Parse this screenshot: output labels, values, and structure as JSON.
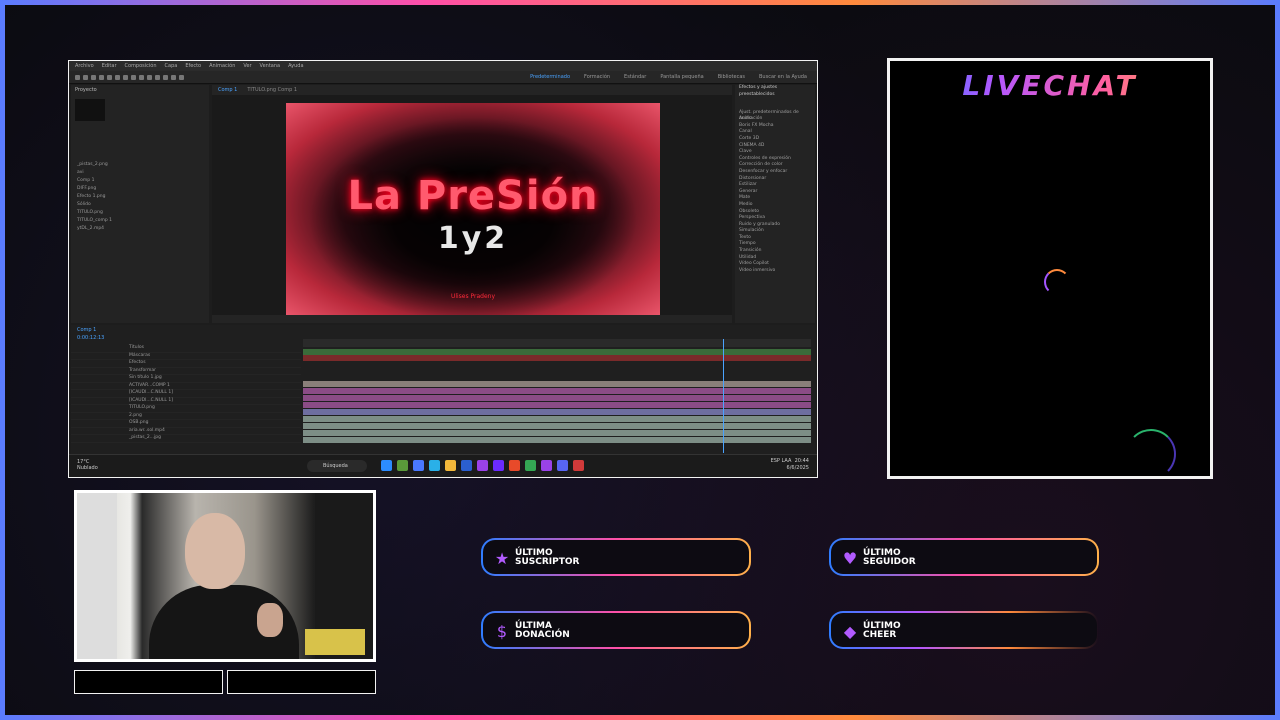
{
  "colors": {
    "accent_blue": "#2f7dff",
    "accent_pink": "#ff4fa8",
    "accent_orange": "#ffb04a",
    "ae_highlight": "#4aa3ff"
  },
  "ae": {
    "menu": [
      "Archivo",
      "Editar",
      "Composición",
      "Capa",
      "Efecto",
      "Animación",
      "Ver",
      "Ventana",
      "Ayuda"
    ],
    "workspaces": [
      "Predeterminado",
      "Formación",
      "Estándar",
      "Pantalla pequeña",
      "Bibliotecas"
    ],
    "search_help": "Buscar en la Ayuda",
    "project_title": "Proyecto",
    "project_items": [
      "_pistas_2.png",
      "avi",
      "Comp 1",
      "DIFF.png",
      "Efecto 1.png",
      "Sólido",
      "TITULO.png",
      "TITULO_comp 1",
      "ytDL_2.mp4"
    ],
    "comp_tabs": [
      "Comp 1",
      "TITULO.png Comp 1"
    ],
    "viewer": {
      "title_line1": "La PreSión",
      "title_line2": "1y2",
      "signature": "Ulises Pradeny"
    },
    "effects_title": "Efectos y ajustes preestablecidos",
    "effects_list": [
      "Ajust. predeterminados de animación",
      "Audio",
      "Boris FX Mocha",
      "Canal",
      "Corte 3D",
      "CINEMA 4D",
      "Clave",
      "Controles de expresión",
      "Corrección de color",
      "Desenfocar y enfocar",
      "Distorsionar",
      "Estilizar",
      "Generar",
      "Mate",
      "Medio",
      "Obsoleto",
      "Perspectiva",
      "Ruido y granulado",
      "Simulación",
      "Texto",
      "Tiempo",
      "Transición",
      "Utilidad",
      "Vídeo Copilot",
      "Vídeo inmersivo"
    ],
    "timeline_tab": "Comp 1",
    "timecode": "0:00:12:13",
    "layers": [
      "Títulos",
      "Máscaras",
      "Efectos",
      "Transformar",
      "Sin título 1.jpg",
      "ACTIVAR...COMP 1",
      "[ICAUDI...C.NULL 1]",
      "[ICAUDI...C.NULL 1]",
      "TITULO.png",
      "2.png",
      "OSB.png",
      "aria.wr..sol.mp4",
      "_pistas_2...jpg"
    ],
    "taskbar": {
      "search": "Búsqueda",
      "left": "17°C Nublado",
      "time": "20:44",
      "date": "6/6/2025",
      "lang": "ESP LAA"
    }
  },
  "chat": {
    "title": "LIVECHAT"
  },
  "alerts": [
    {
      "line1": "ÚLTIMO",
      "line2": "SUSCRIPTOR",
      "icon": "star-icon"
    },
    {
      "line1": "ÚLTIMO",
      "line2": "SEGUIDOR",
      "icon": "heart-icon"
    },
    {
      "line1": "ÚLTIMA",
      "line2": "DONACIÓN",
      "icon": "dollar-icon"
    },
    {
      "line1": "ÚLTIMO",
      "line2": "CHEER",
      "icon": "diamond-icon"
    }
  ]
}
